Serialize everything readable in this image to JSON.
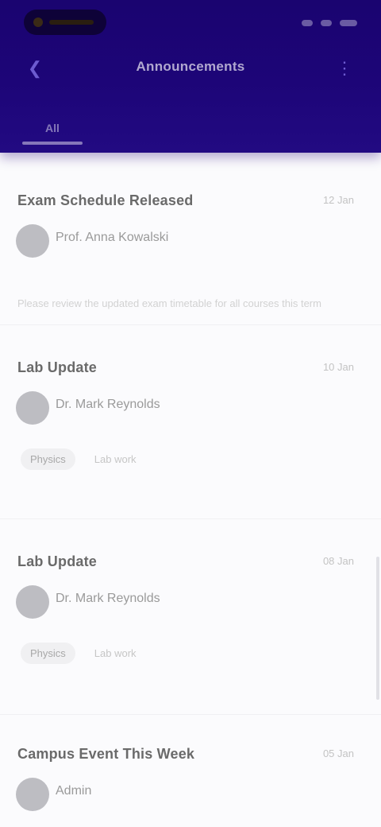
{
  "header": {
    "title": "Announcements",
    "tab_label": "All",
    "back_icon": "arrow-left-icon",
    "menu_icon": "more-vertical-icon"
  },
  "colors": {
    "header_bg": "#1d0578",
    "accent": "#6d5bd0"
  },
  "cards": [
    {
      "title": "Exam Schedule Released",
      "date": "12 Jan",
      "author": "Prof. Anna Kowalski",
      "preview": "Please review the updated exam timetable for all courses this term",
      "tags": []
    },
    {
      "title": "Lab Update",
      "date": "10 Jan",
      "author": "Dr. Mark Reynolds",
      "preview": "",
      "tags": [
        "Physics",
        "Lab work"
      ]
    },
    {
      "title": "Lab Update",
      "date": "08 Jan",
      "author": "Dr. Mark Reynolds",
      "preview": "",
      "tags": [
        "Physics",
        "Lab work"
      ]
    },
    {
      "title": "Campus Event This Week",
      "date": "05 Jan",
      "author": "Admin",
      "preview": "",
      "tags": []
    }
  ]
}
